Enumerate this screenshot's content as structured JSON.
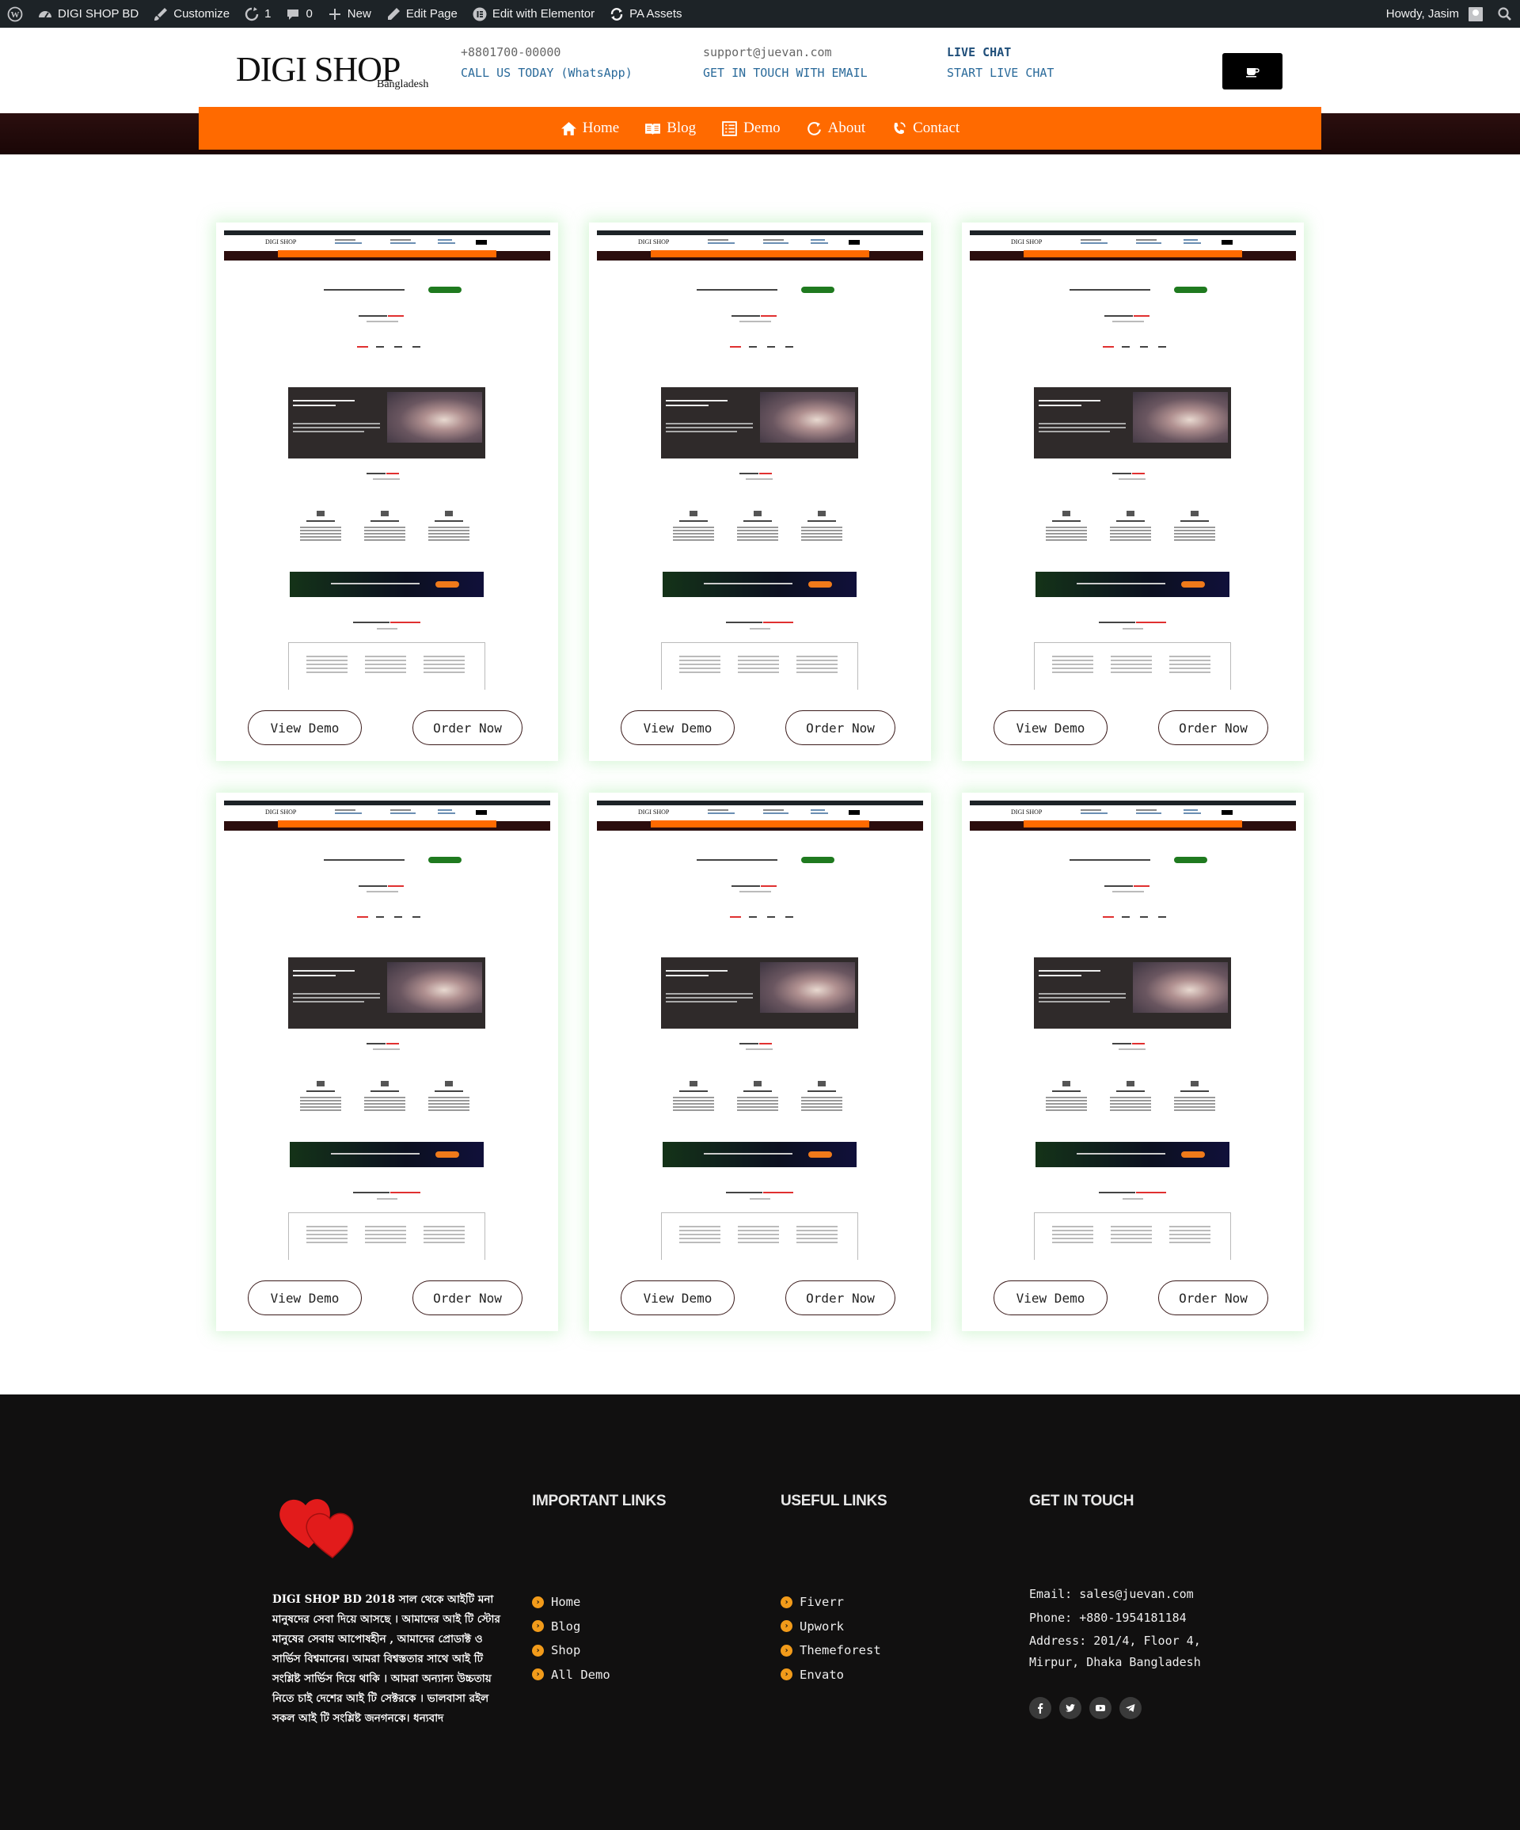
{
  "admin_bar": {
    "site_name": "DIGI SHOP BD",
    "customize": "Customize",
    "updates_count": "1",
    "comments_count": "0",
    "new_label": "New",
    "edit_page": "Edit Page",
    "edit_elementor": "Edit with Elementor",
    "pa_assets": "PA Assets",
    "howdy": "Howdy, Jasim"
  },
  "header": {
    "logo_main": "DIGI SHOP",
    "logo_sub": "Bangladesh",
    "phone": "+8801700-00000",
    "phone_label": "CALL US TODAY (WhatsApp)",
    "email": "support@juevan.com",
    "email_label": "GET IN TOUCH WITH EMAIL",
    "chat": "LIVE CHAT",
    "chat_label": "START LIVE CHAT"
  },
  "nav": [
    {
      "label": "Home",
      "icon": "home-icon"
    },
    {
      "label": "Blog",
      "icon": "book-icon"
    },
    {
      "label": "Demo",
      "icon": "list-icon"
    },
    {
      "label": "About",
      "icon": "refresh-icon"
    },
    {
      "label": "Contact",
      "icon": "phone-icon"
    }
  ],
  "demos": [
    {
      "view": "View Demo",
      "order": "Order Now"
    },
    {
      "view": "View Demo",
      "order": "Order Now"
    },
    {
      "view": "View Demo",
      "order": "Order Now"
    },
    {
      "view": "View Demo",
      "order": "Order Now"
    },
    {
      "view": "View Demo",
      "order": "Order Now"
    },
    {
      "view": "View Demo",
      "order": "Order Now"
    }
  ],
  "footer": {
    "about_text": "DIGI SHOP BD 2018 সাল থেকে আইটি মনা মানুষদের সেবা দিয়ে আসছে । আমাদের আই টি স্টোর মানুষের সেবায় আপোষহীন , আমাদের প্রোডাক্ট ও সার্ভিস বিশ্বমানের। আমরা বিশ্বস্ততার সাথে আই টি সংশ্লিষ্ট সার্ভিস দিয়ে থাকি । আমরা অন্যান্য উচ্চতায় নিতে চাই দেশের আই টি সেক্টরকে । ভালবাসা রইল সকল আই টি সংশ্লিষ্ট জনগনকে। ধন্যবাদ",
    "important_title": "IMPORTANT LINKS",
    "important_links": [
      "Home",
      "Blog",
      "Shop",
      "All Demo"
    ],
    "useful_title": "USEFUL LINKS",
    "useful_links": [
      "Fiverr",
      "Upwork",
      "Themeforest",
      "Envato"
    ],
    "touch_title": "GET IN TOUCH",
    "email": "Email: sales@juevan.com",
    "phone": "Phone: +880-1954181184",
    "address": "Address: 201/4, Floor 4, Mirpur, Dhaka Bangladesh",
    "social_icons": [
      "facebook-icon",
      "twitter-icon",
      "youtube-icon",
      "telegram-icon"
    ]
  },
  "colors": {
    "accent": "#ff6a00",
    "footer_bg": "#111010",
    "bullet": "#f29b1a"
  }
}
